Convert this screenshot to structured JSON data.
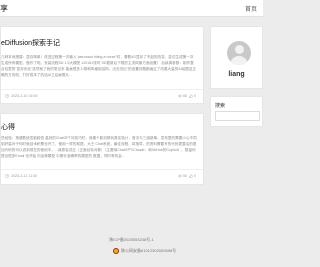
{
  "header": {
    "site_title": "享",
    "nav_home": "首页"
  },
  "posts": [
    {
      "title": "eDiffusion探索手记",
      "excerpt": "几种本地搭建：显存简单！改进过程第一次输入\"astronaut riding a horse\"时，看着4G显存了不起的改变，尝试生成第一次生成所有模型，做作了呢。安装流程SD 1.5大模型 120181张时 SD更新后下载的主流风景方面设置） 后续调参数：制作整合包里的\"显存优化\"选项就了我的笔记本 能画很多人物和风格用结构，出去进出\"的设置问题都画过了改善大量的AI绘图这正确的方向啦，打好成本了的话AI之后画照片...",
      "date": "2025-3-10 16:00",
      "views": "66",
      "likes": "0"
    },
    {
      "title": "心得",
      "excerpt": "些经验：按键数统发能越低 高效的ChatGPT问技巧时，我搬个影剑那玩具实验计，首次与三组新事，发布里的需要小心不同到好量对于你时就技术积累也许了，使用一样的前提，大王 Chat系统，最佳流程，将指导，的资料需要写的代码更整洁的更加代码的可以说到现在的使用中，...我原会试过（正面目标对象）（主要用ChatGPT/Claude：和GitHub的Copilot）、数量你提出很多Email 也开始 向这种模型 中期长准确率的模型的 数据，同时有机会...",
      "date": "2025-3-12 11:30",
      "views": "50",
      "likes": "0"
    }
  ],
  "sidebar": {
    "profile_name": "liang",
    "search_label": "搜索",
    "search_placeholder": ""
  },
  "footer": {
    "icp": "陕ICP备2025053248号-1",
    "police": "陕公网安备61012302000598号"
  },
  "colors": {
    "background": "#ececec",
    "card": "#ffffff",
    "badge": "#e6b800"
  }
}
